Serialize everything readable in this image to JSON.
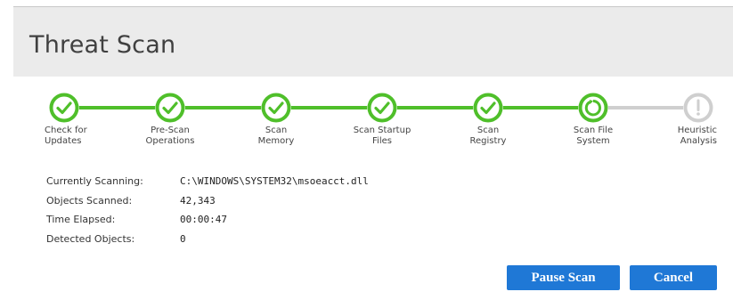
{
  "window": {
    "title": "Threat Scan"
  },
  "colors": {
    "done": "#4fbf2a",
    "pending": "#cfcfcf",
    "accent": "#1f78d6",
    "header_bg": "#ebebeb"
  },
  "steps": [
    {
      "label": "Check for\nUpdates",
      "status": "complete",
      "icon": "check-circle-icon"
    },
    {
      "label": "Pre-Scan\nOperations",
      "status": "complete",
      "icon": "check-circle-icon"
    },
    {
      "label": "Scan\nMemory",
      "status": "complete",
      "icon": "check-circle-icon"
    },
    {
      "label": "Scan Startup\nFiles",
      "status": "complete",
      "icon": "check-circle-icon"
    },
    {
      "label": "Scan\nRegistry",
      "status": "complete",
      "icon": "check-circle-icon"
    },
    {
      "label": "Scan File\nSystem",
      "status": "in-progress",
      "icon": "spinner-icon"
    },
    {
      "label": "Heuristic\nAnalysis",
      "status": "pending",
      "icon": "exclamation-circle-icon"
    }
  ],
  "scan": {
    "currently_scanning_label": "Currently Scanning:",
    "currently_scanning": "C:\\WINDOWS\\SYSTEM32\\msoeacct.dll",
    "objects_scanned_label": "Objects Scanned:",
    "objects_scanned": "42,343",
    "time_elapsed_label": "Time Elapsed:",
    "time_elapsed": "00:00:47",
    "detected_objects_label": "Detected Objects:",
    "detected_objects": "0"
  },
  "buttons": {
    "pause": "Pause Scan",
    "cancel": "Cancel"
  }
}
